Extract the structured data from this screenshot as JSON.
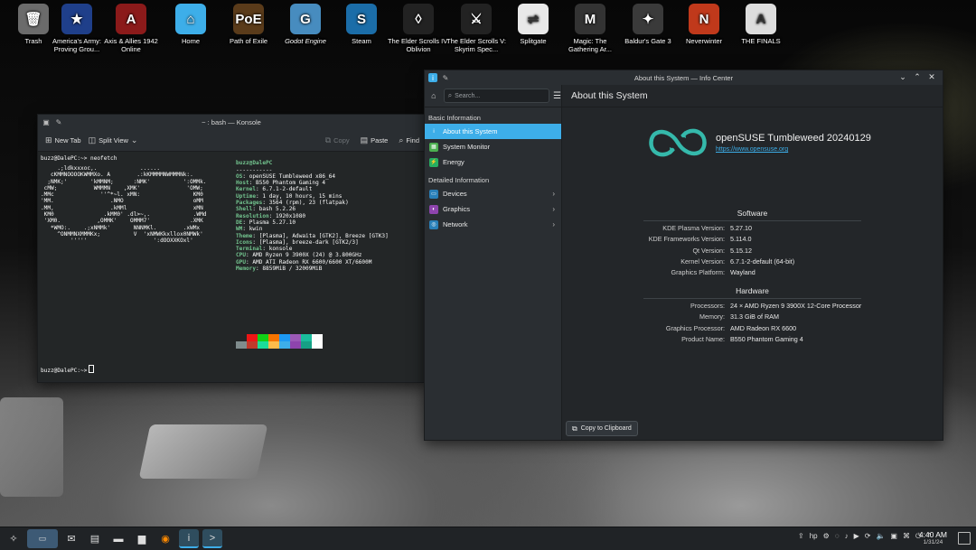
{
  "desktop": {
    "icons": [
      {
        "label": "Trash",
        "glyph": "🗑",
        "color": "#6b6b6b",
        "italic": false
      },
      {
        "label": "America's Army: Proving Grou...",
        "glyph": "★",
        "color": "#1f3f8a",
        "italic": false
      },
      {
        "label": "Axis & Allies 1942 Online",
        "glyph": "A",
        "color": "#8b1a1a",
        "italic": false
      },
      {
        "label": "Home",
        "glyph": "⌂",
        "color": "#3daee9",
        "italic": false
      },
      {
        "label": "Path of Exile",
        "glyph": "PoE",
        "color": "#5a3b1a",
        "italic": false
      },
      {
        "label": "Godot Engine",
        "glyph": "G",
        "color": "#478cbf",
        "italic": true
      },
      {
        "label": "Steam",
        "glyph": "S",
        "color": "#1b6da8",
        "italic": false
      },
      {
        "label": "The Elder Scrolls IV: Oblivion",
        "glyph": "◊",
        "color": "#222222",
        "italic": false
      },
      {
        "label": "The Elder Scrolls V: Skyrim Spec...",
        "glyph": "⚔",
        "color": "#222222",
        "italic": false
      },
      {
        "label": "Splitgate",
        "glyph": "⇌",
        "color": "#e8e8e8",
        "italic": false
      },
      {
        "label": "Magic: The Gathering Ar...",
        "glyph": "M",
        "color": "#333333",
        "italic": false
      },
      {
        "label": "Baldur's Gate 3",
        "glyph": "✦",
        "color": "#3a3a3a",
        "italic": false
      },
      {
        "label": "Neverwinter",
        "glyph": "N",
        "color": "#c0391b",
        "italic": false
      },
      {
        "label": "THE FINALS",
        "glyph": "A",
        "color": "#dddddd",
        "italic": false
      }
    ]
  },
  "konsole": {
    "title": "~ : bash — Konsole",
    "toolbar": {
      "new_tab": "New Tab",
      "split_view": "Split View",
      "copy": "Copy",
      "paste": "Paste",
      "find": "Find"
    },
    "prompt_line": "buzz@DalePC:~> neofetch",
    "ascii": "     .;ldkxxxoc,.             ......\n   cKMMNOOOOKWMMXo. A        .:kKMMMMNWMMMNk:.\n  ;NMK;'       'kMMNM;      :NMK'          ':OMMk.\n cMW;           WMMMN    ,XMK'              'OMW;\n.MMc              ''^*~l. xMN:                KM0\n'MM.                 .NMO                     oMM\n.MM,                 .kMMl                    xMN\n KM0               .kMM0' .dl>~,.             .WMd\n 'XM0.           ,OMMK'    OMMM7'            .XMK\n   *WMO:.    .;xNMMk'       NNNMKl.        .xWMx\n     ^ONMMNXMMMKx;          V  'xNMWKkxllox0NMWk'\n         '''''                    ':dOOXXKOxl'",
    "info_header": "buzz@DalePC",
    "info_sep": "-----------",
    "info": [
      {
        "k": "OS",
        "v": "openSUSE Tumbleweed x86_64"
      },
      {
        "k": "Host",
        "v": "B550 Phantom Gaming 4"
      },
      {
        "k": "Kernel",
        "v": "6.7.1-2-default"
      },
      {
        "k": "Uptime",
        "v": "1 day, 10 hours, 15 mins"
      },
      {
        "k": "Packages",
        "v": "3564 (rpm), 23 (flatpak)"
      },
      {
        "k": "Shell",
        "v": "bash 5.2.26"
      },
      {
        "k": "Resolution",
        "v": "1920x1080"
      },
      {
        "k": "DE",
        "v": "Plasma 5.27.10"
      },
      {
        "k": "WM",
        "v": "kwin"
      },
      {
        "k": "Theme",
        "v": "[Plasma], Adwaita [GTK2], Breeze [GTK3]"
      },
      {
        "k": "Icons",
        "v": "[Plasma], breeze-dark [GTK2/3]"
      },
      {
        "k": "Terminal",
        "v": "konsole"
      },
      {
        "k": "CPU",
        "v": "AMD Ryzen 9 3900X (24) @ 3.800GHz"
      },
      {
        "k": "GPU",
        "v": "AMD ATI Radeon RX 6600/6600 XT/6600M"
      },
      {
        "k": "Memory",
        "v": "8859MiB / 32009MiB"
      }
    ],
    "palette_row1": [
      "#232627",
      "#ed1515",
      "#11d116",
      "#f67400",
      "#1d99f3",
      "#9b59b6",
      "#1abc9c",
      "#fcfcfc"
    ],
    "palette_row2": [
      "#7f8c8d",
      "#c0392b",
      "#1cdc9a",
      "#fdbc4b",
      "#3daee9",
      "#8e44ad",
      "#16a085",
      "#ffffff"
    ],
    "prompt2": "buzz@DalePC:~>"
  },
  "infocenter": {
    "title": "About this System — Info Center",
    "search_placeholder": "Search...",
    "header": "About this System",
    "section_basic": "Basic Information",
    "section_detailed": "Detailed Information",
    "basic_items": [
      {
        "label": "About this System",
        "color": "#3daee9",
        "glyph": "i",
        "selected": true
      },
      {
        "label": "System Monitor",
        "color": "#4caf50",
        "glyph": "▦",
        "selected": false
      },
      {
        "label": "Energy",
        "color": "#27ae60",
        "glyph": "⚡",
        "selected": false
      }
    ],
    "detailed_items": [
      {
        "label": "Devices",
        "color": "#2980b9",
        "glyph": "▭"
      },
      {
        "label": "Graphics",
        "color": "#8e44ad",
        "glyph": "◐"
      },
      {
        "label": "Network",
        "color": "#2980b9",
        "glyph": "◎"
      }
    ],
    "distro_name": "openSUSE Tumbleweed 20240129",
    "distro_url": "https://www.opensuse.org",
    "software_title": "Software",
    "software": [
      {
        "k": "KDE Plasma Version:",
        "v": "5.27.10"
      },
      {
        "k": "KDE Frameworks Version:",
        "v": "5.114.0"
      },
      {
        "k": "Qt Version:",
        "v": "5.15.12"
      },
      {
        "k": "Kernel Version:",
        "v": "6.7.1-2-default (64-bit)"
      },
      {
        "k": "Graphics Platform:",
        "v": "Wayland"
      }
    ],
    "hardware_title": "Hardware",
    "hardware": [
      {
        "k": "Processors:",
        "v": "24 × AMD Ryzen 9 3900X 12-Core Processor"
      },
      {
        "k": "Memory:",
        "v": "31.3 GiB of RAM"
      },
      {
        "k": "Graphics Processor:",
        "v": "AMD Radeon RX 6600"
      },
      {
        "k": "Product Name:",
        "v": "B550 Phantom Gaming 4"
      }
    ],
    "copy_button": "Copy to Clipboard",
    "accent": "#3daee9",
    "logo_color": "#35b9ab"
  },
  "taskbar": {
    "time": "4:40 AM",
    "date": "1/31/24",
    "items": [
      {
        "name": "app-launcher-icon",
        "glyph": "✧",
        "active": false
      },
      {
        "name": "pager-icon",
        "glyph": "▭",
        "active": false
      },
      {
        "name": "mail-icon",
        "glyph": "✉",
        "active": false
      },
      {
        "name": "system-settings-icon",
        "glyph": "▤",
        "active": false
      },
      {
        "name": "terminal-icon",
        "glyph": "▬",
        "active": false
      },
      {
        "name": "file-manager-icon",
        "glyph": "▆",
        "active": false
      },
      {
        "name": "firefox-icon",
        "glyph": "◉",
        "active": false
      },
      {
        "name": "info-center-icon",
        "glyph": "i",
        "active": true
      },
      {
        "name": "konsole-icon",
        "glyph": ">",
        "active": true
      }
    ],
    "tray": [
      "⇪",
      "hp",
      "⚙",
      "◌",
      "♪",
      "▶",
      "⟳",
      "🔈",
      "▣",
      "⌘",
      "⏻",
      "⌃"
    ]
  }
}
